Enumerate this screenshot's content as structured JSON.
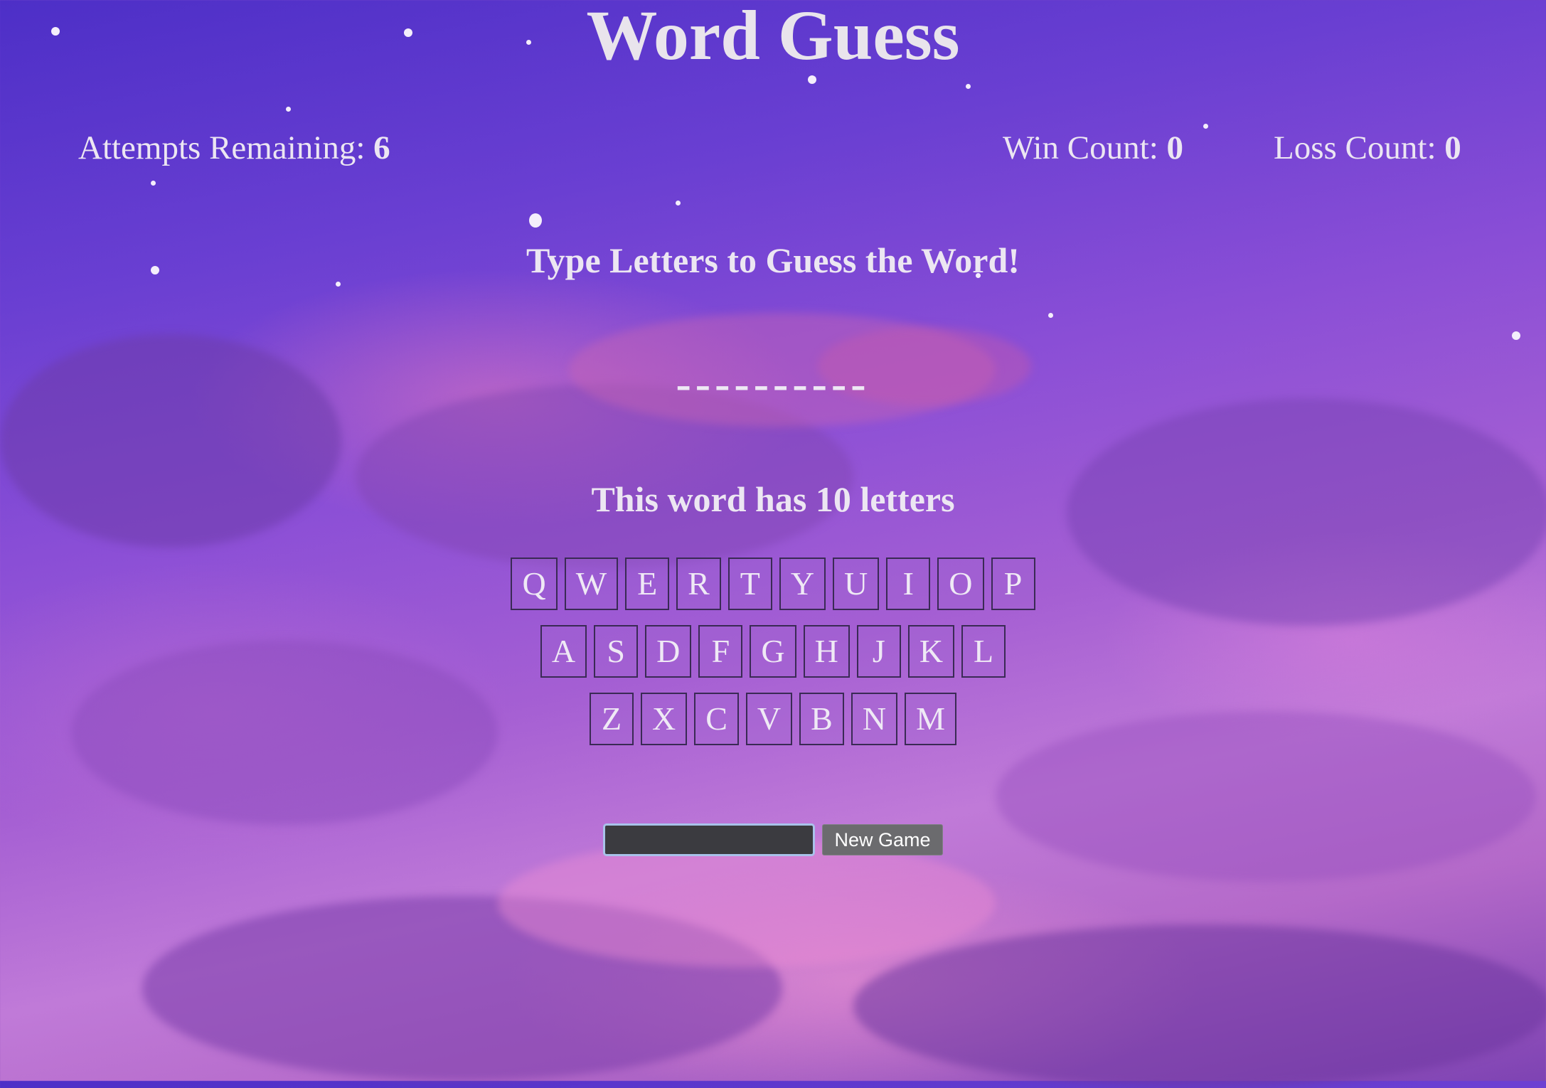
{
  "game": {
    "title": "Word Guess"
  },
  "stats": {
    "attempts_label": "Attempts Remaining: ",
    "attempts_value": "6",
    "wins_label": "Win Count: ",
    "wins_value": "0",
    "losses_label": "Loss Count: ",
    "losses_value": "0"
  },
  "prompt": {
    "instruction": "Type Letters to Guess the Word!",
    "word_display": "----------",
    "letter_count": "This word has 10 letters"
  },
  "keyboard": {
    "rows": [
      [
        "Q",
        "W",
        "E",
        "R",
        "T",
        "Y",
        "U",
        "I",
        "O",
        "P"
      ],
      [
        "A",
        "S",
        "D",
        "F",
        "G",
        "H",
        "J",
        "K",
        "L"
      ],
      [
        "Z",
        "X",
        "C",
        "V",
        "B",
        "N",
        "M"
      ]
    ]
  },
  "controls": {
    "input_value": "",
    "new_game_label": "New Game"
  },
  "colors": {
    "text": "#ece6f2",
    "background_top": "#4d2fc7",
    "background_bottom": "#c07ad8",
    "input_border": "#a9c2ea",
    "button_bg": "#6b6b6e"
  }
}
